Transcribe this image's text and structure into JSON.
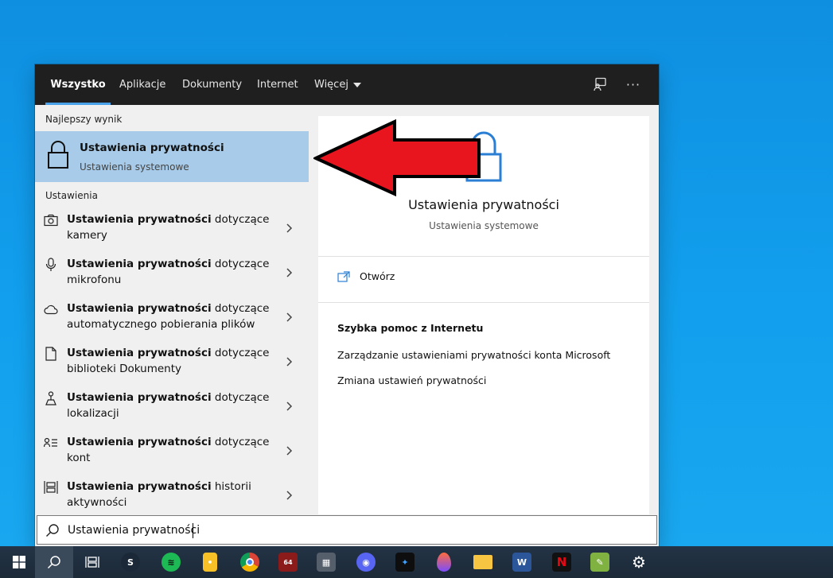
{
  "tabs": {
    "all": "Wszystko",
    "apps": "Aplikacje",
    "documents": "Dokumenty",
    "internet": "Internet",
    "more": "Więcej"
  },
  "left": {
    "best_header": "Najlepszy wynik",
    "best_title": "Ustawienia prywatności",
    "best_subtitle": "Ustawienia systemowe",
    "settings_header": "Ustawienia",
    "items": [
      {
        "bold": "Ustawienia prywatności",
        "rest": " dotyczące",
        "line2": "kamery",
        "icon": "camera-icon"
      },
      {
        "bold": "Ustawienia prywatności",
        "rest": " dotyczące",
        "line2": "mikrofonu",
        "icon": "microphone-icon"
      },
      {
        "bold": "Ustawienia prywatności",
        "rest": " dotyczące",
        "line2": "automatycznego pobierania plików",
        "icon": "cloud-icon"
      },
      {
        "bold": "Ustawienia prywatności",
        "rest": " dotyczące",
        "line2": "biblioteki Dokumenty",
        "icon": "document-icon"
      },
      {
        "bold": "Ustawienia prywatności",
        "rest": " dotyczące",
        "line2": "lokalizacji",
        "icon": "location-icon"
      },
      {
        "bold": "Ustawienia prywatności",
        "rest": " dotyczące",
        "line2": "kont",
        "icon": "accounts-icon"
      },
      {
        "bold": "Ustawienia prywatności",
        "rest": " historii",
        "line2": "aktywności",
        "icon": "activity-history-icon"
      }
    ]
  },
  "right": {
    "title": "Ustawienia prywatności",
    "subtitle": "Ustawienia systemowe",
    "open_label": "Otwórz",
    "help_title": "Szybka pomoc z Internetu",
    "help_links": [
      "Zarządzanie ustawieniami prywatności konta Microsoft",
      "Zmiana ustawień prywatności"
    ]
  },
  "search": {
    "value": "Ustawienia prywatności"
  },
  "colors": {
    "desktop": "#1a9be6",
    "highlight": "#a7cbe9",
    "tab_underline": "#4aa3ea",
    "arrow": "#e8151f"
  }
}
